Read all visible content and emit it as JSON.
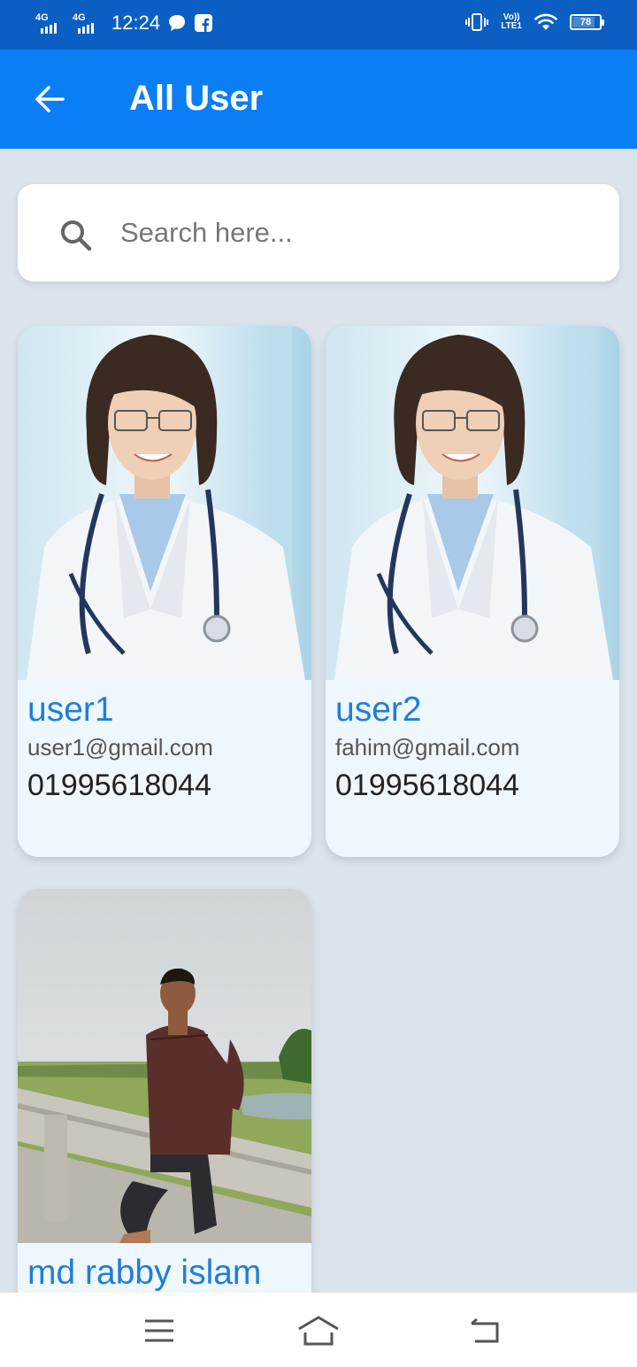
{
  "status_bar": {
    "network_1": "4G",
    "network_2": "4G",
    "time": "12:24",
    "volte_top": "Vo))",
    "volte_bottom": "LTE1",
    "battery_level": 78,
    "battery_text": "78",
    "icons": [
      "signal-icon",
      "signal-icon",
      "chat-bubble-icon",
      "facebook-icon",
      "vibrate-icon",
      "volte-icon",
      "wifi-icon",
      "battery-icon"
    ]
  },
  "app_bar": {
    "title": "All User",
    "back_icon": "arrow-left-icon",
    "color": "#0a7ef4"
  },
  "search": {
    "placeholder": "Search here...",
    "value": "",
    "icon": "search-icon"
  },
  "users": [
    {
      "name": "user1",
      "email": "user1@gmail.com",
      "phone": "01995618044"
    },
    {
      "name": "user2",
      "email": "fahim@gmail.com",
      "phone": "01995618044"
    },
    {
      "name": "md rabby islam"
    }
  ],
  "nav_bar": {
    "icons": [
      "menu-icon",
      "home-icon",
      "back-icon"
    ]
  },
  "colors": {
    "status_bar": "#0b5fc2",
    "app_bar": "#0a7ef4",
    "background": "#dbe3ec",
    "card": "#eef6fe",
    "name_text": "#1e7fd6"
  }
}
